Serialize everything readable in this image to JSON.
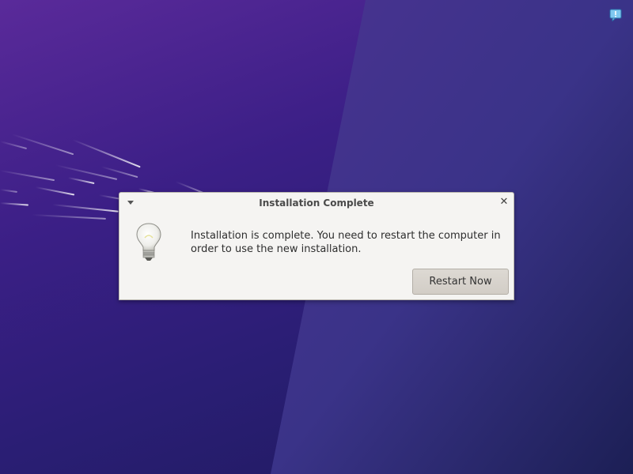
{
  "desktop": {
    "notification_icon": "speech-bubble-alert-icon"
  },
  "dialog": {
    "title": "Installation Complete",
    "menu_icon": "window-menu-arrow-icon",
    "close_icon": "close-icon",
    "close_glyph": "✕",
    "info_icon": "lightbulb-icon",
    "message": "Installation is complete. You need to restart the computer in order to use the new installation.",
    "restart_label": "Restart Now"
  },
  "colors": {
    "desktop_top": "#5a2a9a",
    "desktop_bottom": "#1e1a5c",
    "dialog_bg": "#f5f4f2",
    "button_bg": "#d6d1cb"
  }
}
